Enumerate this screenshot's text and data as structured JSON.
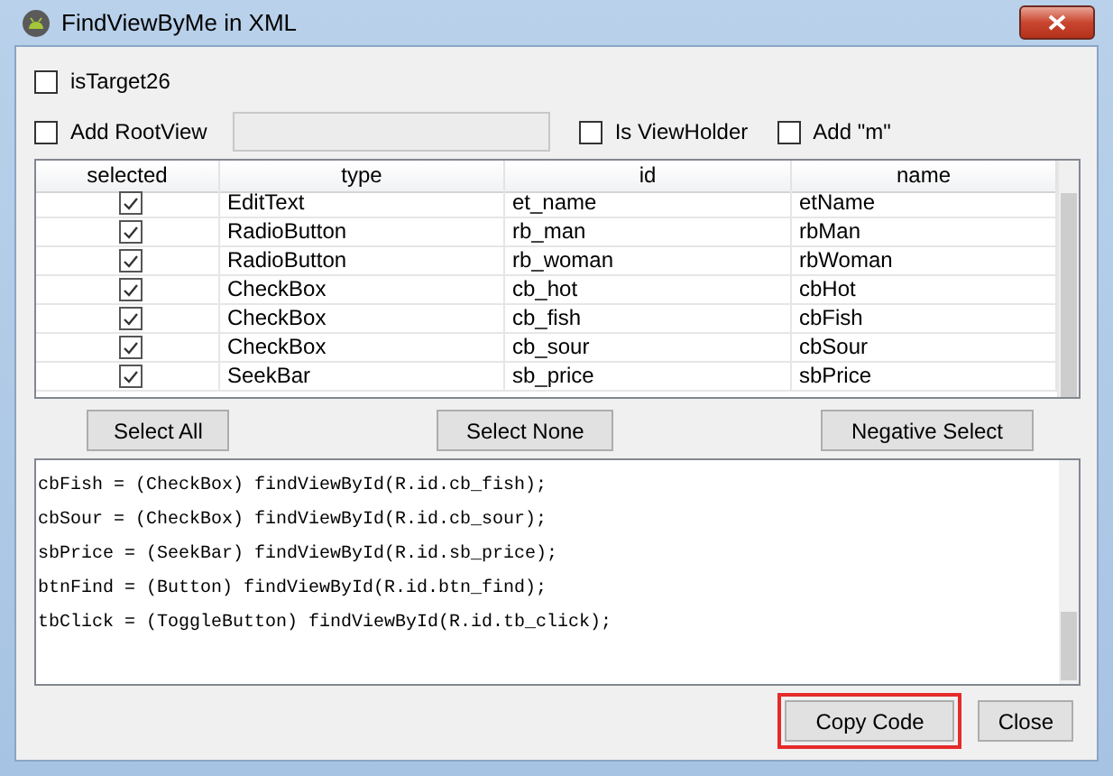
{
  "window": {
    "title": "FindViewByMe in XML"
  },
  "options": [
    {
      "label": "isTarget26",
      "checked": false
    }
  ],
  "option_row": [
    {
      "kind": "checkbox",
      "label": "Add RootView",
      "checked": false
    },
    {
      "kind": "field"
    },
    {
      "kind": "checkbox",
      "label": "Is ViewHolder",
      "checked": false
    },
    {
      "kind": "checkbox",
      "label": "Add \"m\"",
      "checked": false
    }
  ],
  "table": {
    "columns": [
      "selected",
      "type",
      "id",
      "name"
    ],
    "rows": [
      {
        "checked": true,
        "type": "EditText",
        "id": "et_name",
        "name": "etName"
      },
      {
        "checked": true,
        "type": "RadioButton",
        "id": "rb_man",
        "name": "rbMan"
      },
      {
        "checked": true,
        "type": "RadioButton",
        "id": "rb_woman",
        "name": "rbWoman"
      },
      {
        "checked": true,
        "type": "CheckBox",
        "id": "cb_hot",
        "name": "cbHot"
      },
      {
        "checked": true,
        "type": "CheckBox",
        "id": "cb_fish",
        "name": "cbFish"
      },
      {
        "checked": true,
        "type": "CheckBox",
        "id": "cb_sour",
        "name": "cbSour"
      },
      {
        "checked": true,
        "type": "SeekBar",
        "id": "sb_price",
        "name": "sbPrice"
      }
    ]
  },
  "selection_buttons": [
    "Select All",
    "Select None",
    "Negative Select"
  ],
  "code_lines": [
    "cbFish = (CheckBox) findViewById(R.id.cb_fish);",
    "cbSour = (CheckBox) findViewById(R.id.cb_sour);",
    "sbPrice = (SeekBar) findViewById(R.id.sb_price);",
    "btnFind = (Button) findViewById(R.id.btn_find);",
    "tbClick = (ToggleButton) findViewById(R.id.tb_click);"
  ],
  "footer_buttons": [
    {
      "label": "Copy Code",
      "highlighted": true
    },
    {
      "label": "Close",
      "highlighted": false
    }
  ]
}
